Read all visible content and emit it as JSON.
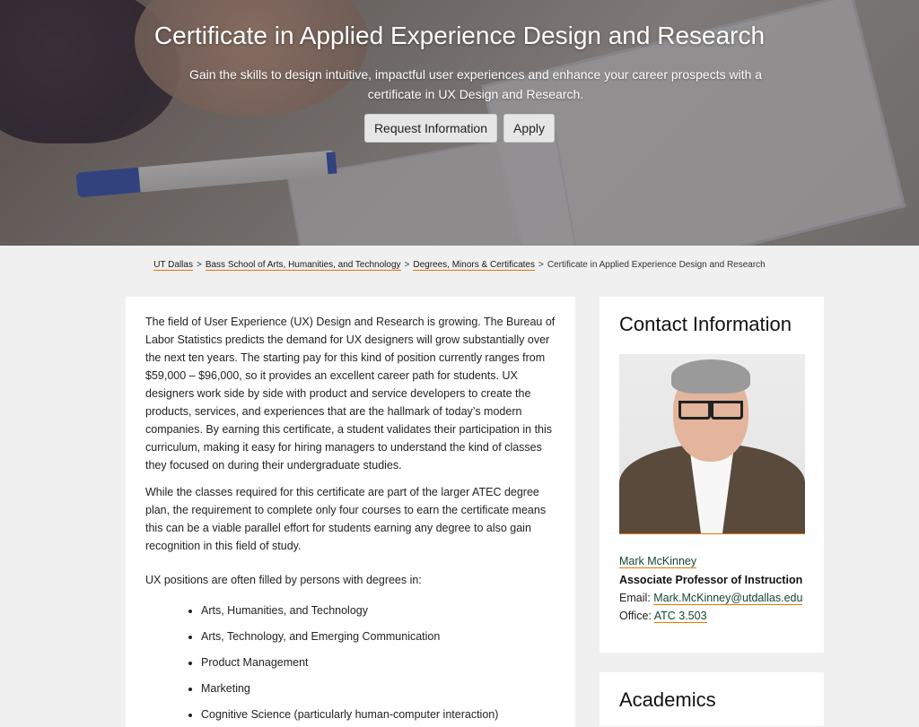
{
  "hero": {
    "title": "Certificate in Applied Experience Design and Research",
    "subtitle": "Gain the skills to design intuitive, impactful user experiences and enhance your career prospects with a certificate in UX Design and Research.",
    "request_label": "Request Information",
    "apply_label": "Apply"
  },
  "breadcrumb": {
    "items": [
      "UT Dallas",
      "Bass School of Arts, Humanities, and Technology",
      "Degrees, Minors & Certificates"
    ],
    "current": "Certificate in Applied Experience Design and Research",
    "separator": ">"
  },
  "main": {
    "paragraph1": "The field of User Experience (UX) Design and Research is growing. The Bureau of Labor Statistics predicts the demand for UX designers will grow substantially over the next ten years. The starting pay for this kind of position currently ranges from $59,000 – $96,000, so it provides an excellent career path for students. UX designers work side by side with product and service developers to create the products, services, and experiences that are the hallmark of today’s modern companies. By earning this certificate, a student validates their participation in this curriculum, making it easy for hiring managers to understand the kind of classes they focused on during their undergraduate studies.",
    "paragraph2": "While the classes required for this certificate are part of the larger ATEC degree plan, the requirement to complete only four courses to earn the certificate means this can be a viable parallel effort for students earning any degree to also gain recognition in this field of study.",
    "list_intro": "UX positions are often filled by persons with degrees in:",
    "degrees": [
      "Arts, Humanities, and Technology",
      "Arts, Technology, and Emerging Communication",
      "Product Management",
      "Marketing",
      "Cognitive Science (particularly human-computer interaction)"
    ]
  },
  "contact": {
    "title": "Contact Information",
    "name": "Mark McKinney",
    "role": "Associate Professor of Instruction",
    "email_label": "Email:",
    "email": "Mark.McKinney@utdallas.edu",
    "office_label": "Office:",
    "office": "ATC 3.503"
  },
  "academics": {
    "title": "Academics"
  },
  "colors": {
    "accent_orange": "#e87500",
    "link_green": "#154734",
    "page_bg": "#f0f0f0"
  }
}
